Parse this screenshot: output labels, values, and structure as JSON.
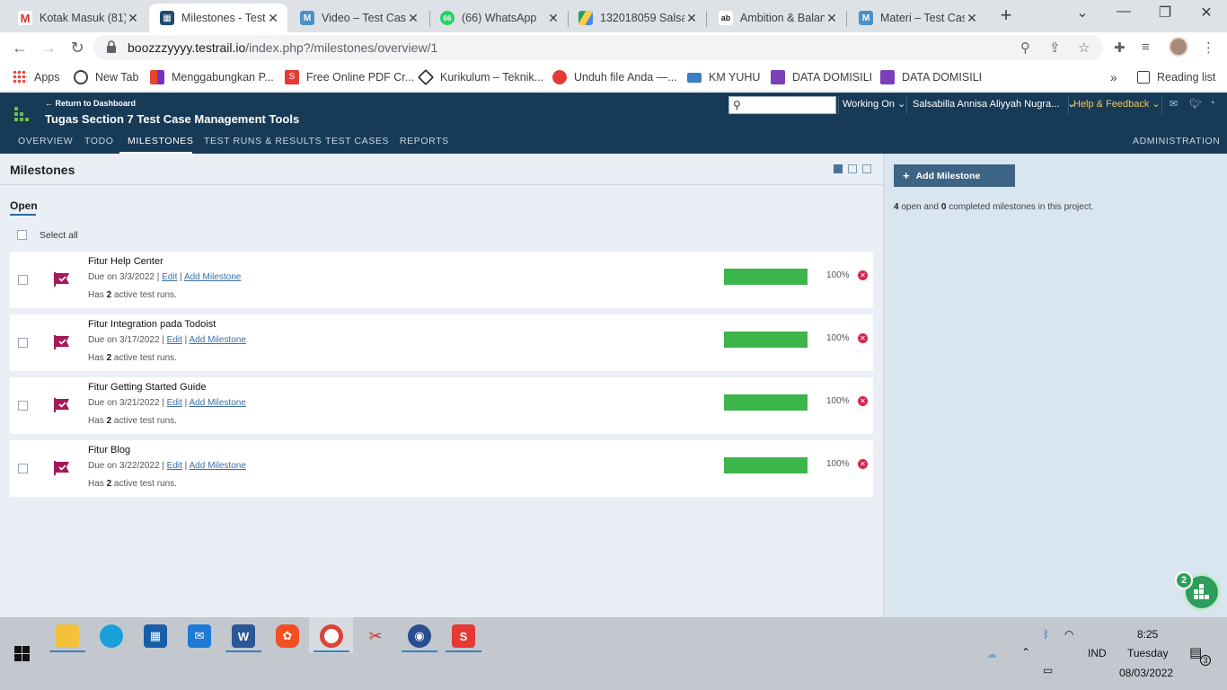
{
  "browser": {
    "tabs": [
      {
        "title": "Kotak Masuk (81)",
        "icon": "gmail-icon",
        "color": "#d93025"
      },
      {
        "title": "Milestones - Test",
        "icon": "testrail-icon",
        "color": "#1e4a6e"
      },
      {
        "title": "Video – Test Case",
        "icon": "m-icon",
        "color": "#4a90c9"
      },
      {
        "title": "(66) WhatsApp",
        "icon": "whatsapp-icon",
        "color": "#25d366"
      },
      {
        "title": "132018059 Salsa",
        "icon": "drive-icon",
        "color": "#1fa463"
      },
      {
        "title": "Ambition & Balan",
        "icon": "ab-icon",
        "color": "#222222"
      },
      {
        "title": "Materi – Test Cas",
        "icon": "m-icon",
        "color": "#4a90c9"
      }
    ],
    "url_host": "boozzzyyyy.testrail.io",
    "url_path": "/index.php?/milestones/overview/1",
    "bookmarks": [
      "Apps",
      "New Tab",
      "Menggabungkan P...",
      "Free Online PDF Cr...",
      "Kurikulum – Teknik...",
      "Unduh file Anda —...",
      "KM YUHU",
      "DATA DOMISILI",
      "DATA DOMISILI"
    ],
    "reading_list": "Reading list"
  },
  "header": {
    "return": "← Return to Dashboard",
    "project": "Tugas Section 7 Test Case Management Tools",
    "working_on": "Working On",
    "user": "Salsabilla Annisa Aliyyah Nugra...",
    "help": "Help & Feedback",
    "nav": [
      "OVERVIEW",
      "TODO",
      "MILESTONES",
      "TEST RUNS & RESULTS",
      "TEST CASES",
      "REPORTS"
    ],
    "admin": "ADMINISTRATION"
  },
  "main": {
    "title": "Milestones",
    "section": "Open",
    "select_all": "Select all",
    "edit": "Edit",
    "add_milestone_link": "Add Milestone",
    "milestones": [
      {
        "name": "Fitur Help Center",
        "due": "Due on 3/3/2022 |",
        "runs_pre": "Has",
        "runs_count": "2",
        "runs_post": "active test runs.",
        "progress": 100,
        "pct": "100%"
      },
      {
        "name": "Fitur Integration pada Todoist",
        "due": "Due on 3/17/2022 |",
        "runs_pre": "Has",
        "runs_count": "2",
        "runs_post": "active test runs.",
        "progress": 100,
        "pct": "100%"
      },
      {
        "name": "Fitur Getting Started Guide",
        "due": "Due on 3/21/2022 |",
        "runs_pre": "Has",
        "runs_count": "2",
        "runs_post": "active test runs.",
        "progress": 100,
        "pct": "100%"
      },
      {
        "name": "Fitur Blog",
        "due": "Due on 3/22/2022 |",
        "runs_pre": "Has",
        "runs_count": "2",
        "runs_post": "active test runs.",
        "progress": 100,
        "pct": "100%"
      }
    ]
  },
  "sidebar": {
    "add_button": "Add Milestone",
    "open_count": "4",
    "summary_mid": "open and",
    "completed_count": "0",
    "summary_end": "completed milestones in this project."
  },
  "fab": {
    "badge": "2"
  },
  "taskbar": {
    "lang": "IND",
    "time": "8:25",
    "day": "Tuesday",
    "date": "08/03/2022",
    "notif_count": "3"
  },
  "colors": {
    "header": "#173a56",
    "progress": "#3cb54a",
    "milestone_flag": "#a3195b",
    "accent_help": "#f5c257"
  }
}
